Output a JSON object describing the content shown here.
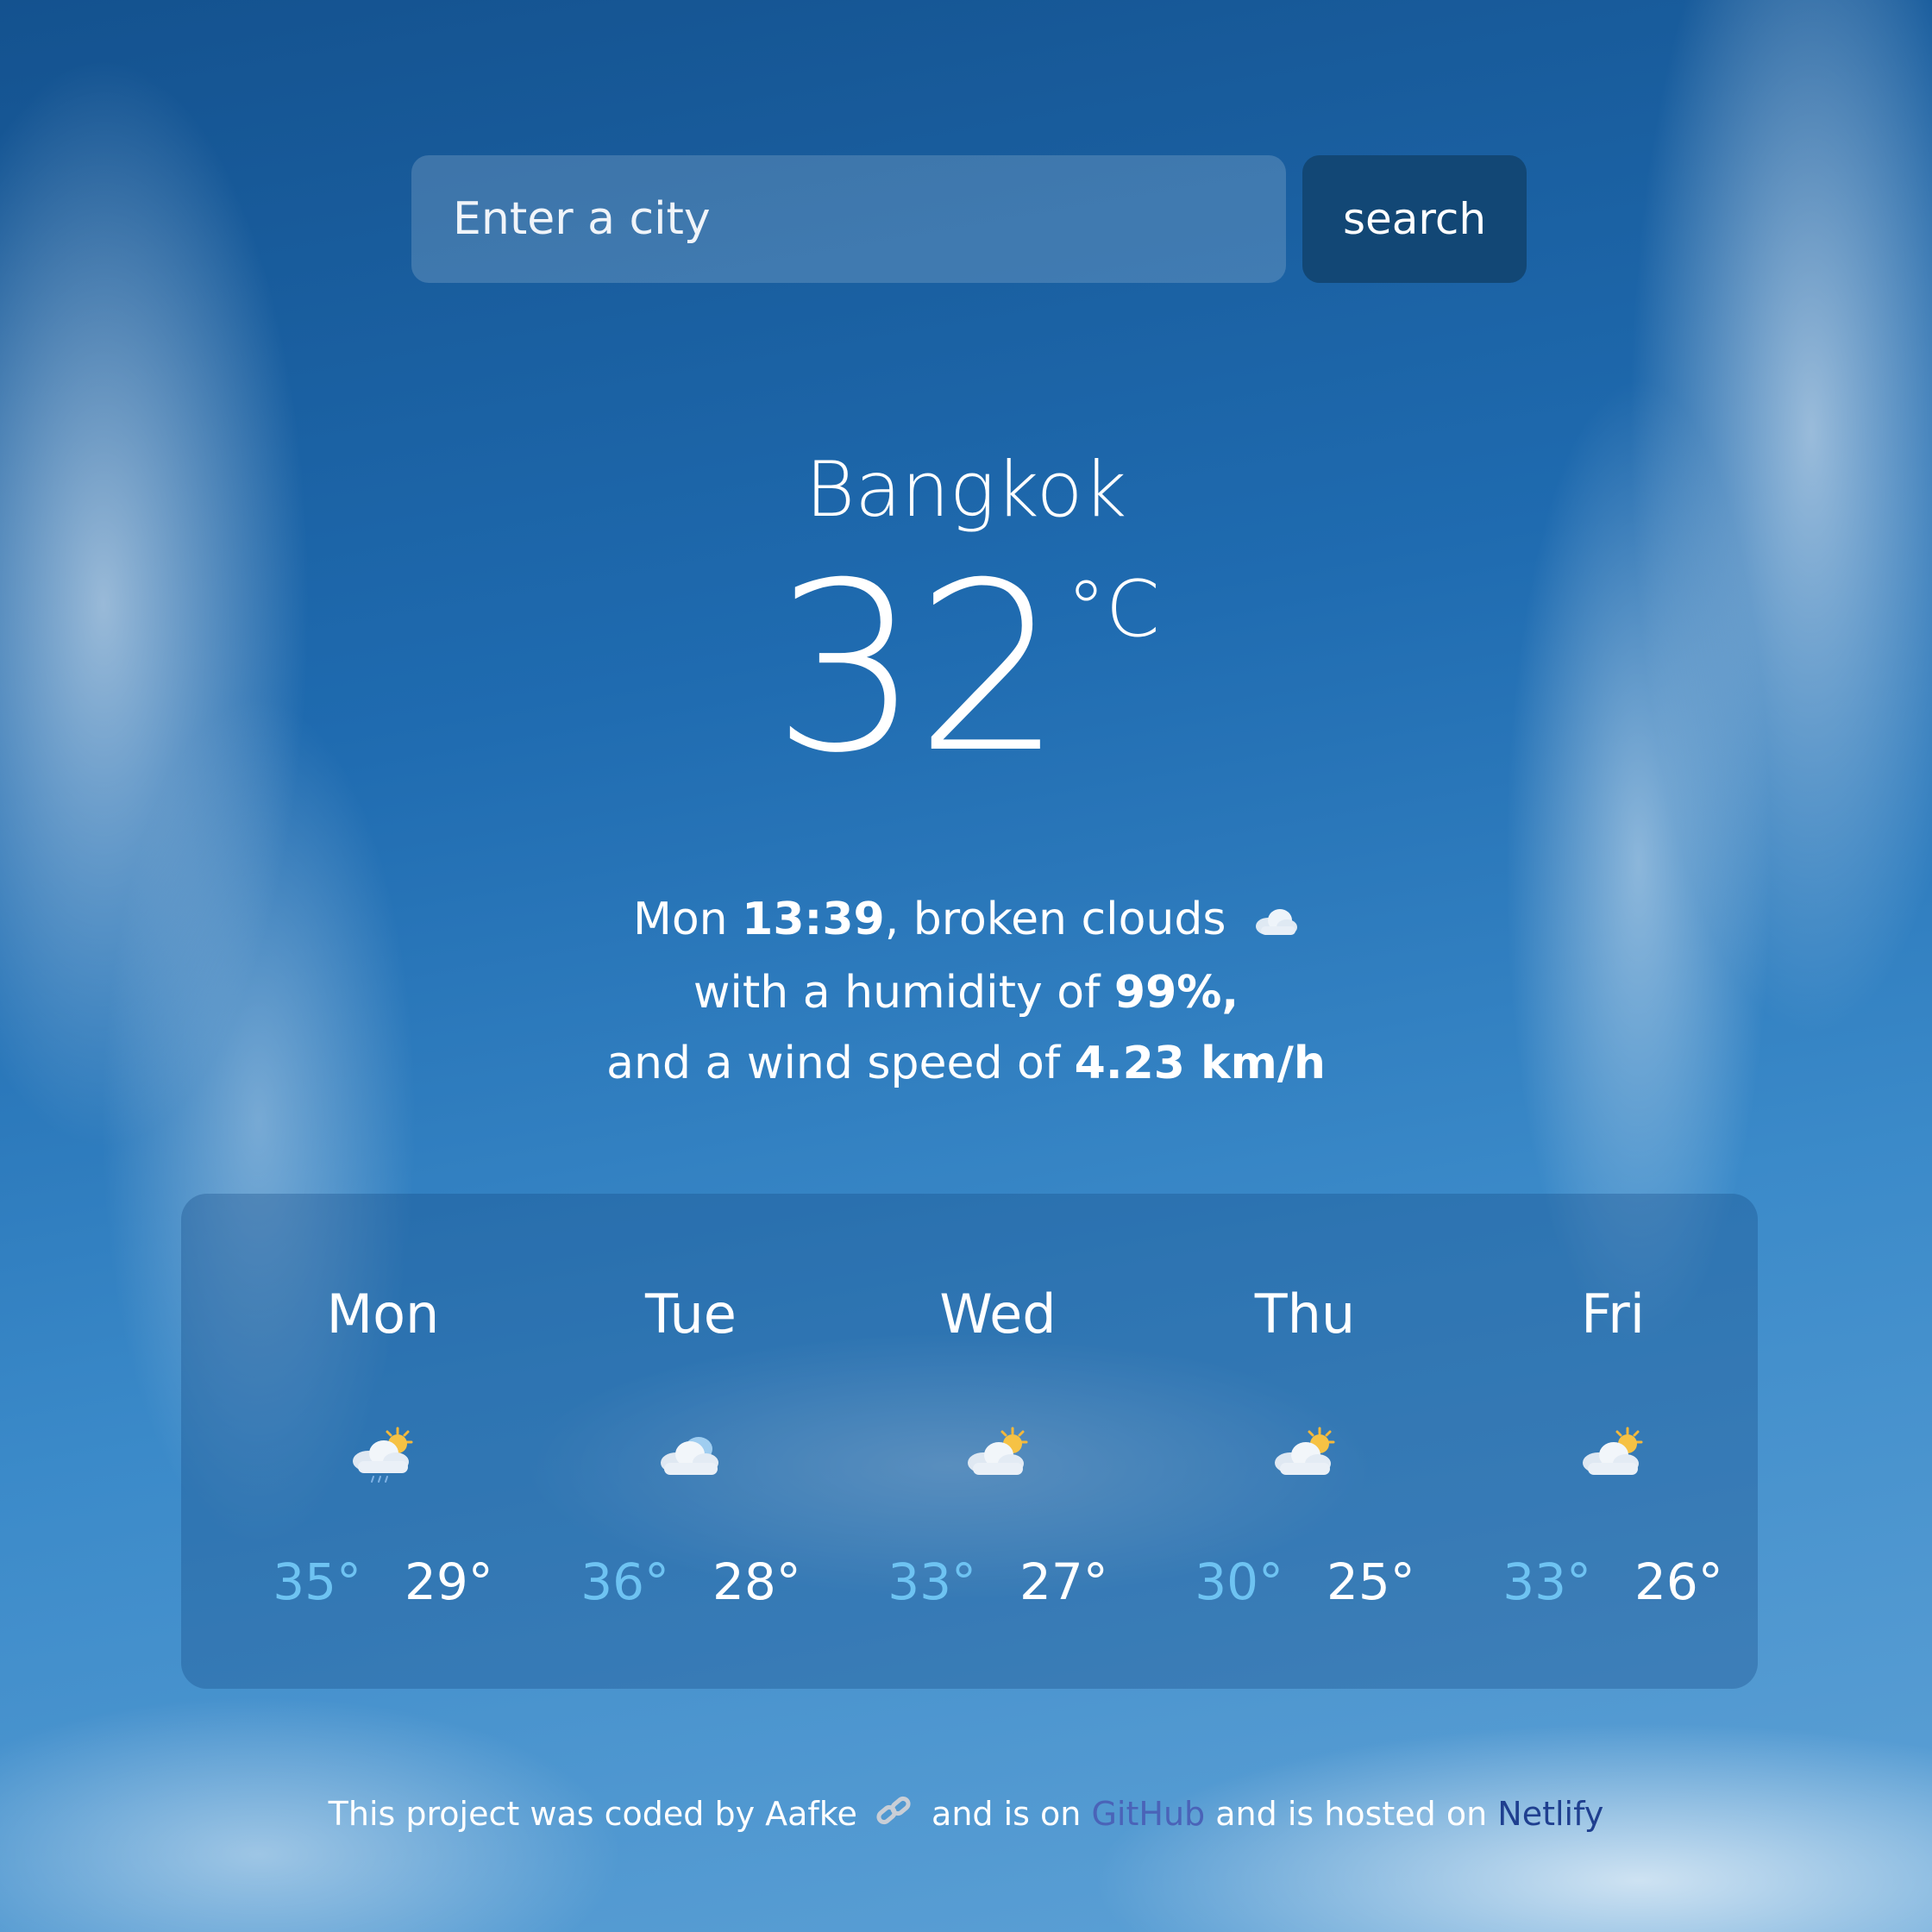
{
  "search": {
    "placeholder": "Enter a city",
    "button_label": "search"
  },
  "current": {
    "city": "Bangkok",
    "temperature": "32",
    "unit": "°C",
    "day": "Mon",
    "time": "13:39",
    "condition": "broken clouds",
    "condition_icon": "cloud-icon",
    "humidity_prefix": "with a humidity of",
    "humidity": "99%,",
    "wind_prefix": "and a wind speed of",
    "wind": "4.23 km/h"
  },
  "forecast": [
    {
      "day": "Mon",
      "icon": "sun-cloud-rain-icon",
      "max": "35°",
      "min": "29°"
    },
    {
      "day": "Tue",
      "icon": "cloud-icon",
      "max": "36°",
      "min": "28°"
    },
    {
      "day": "Wed",
      "icon": "sun-cloud-icon",
      "max": "33°",
      "min": "27°"
    },
    {
      "day": "Thu",
      "icon": "sun-cloud-icon",
      "max": "30°",
      "min": "25°"
    },
    {
      "day": "Fri",
      "icon": "sun-cloud-icon",
      "max": "33°",
      "min": "26°"
    }
  ],
  "footer": {
    "text_1": "This project was coded by Aafke",
    "link_icon": "link-icon",
    "text_2": "and is on",
    "github": "GitHub",
    "text_3": "and is hosted on",
    "netlify": "Netlify"
  },
  "colors": {
    "max_temp": "#6ec3f2",
    "button": "#124775",
    "github_link": "#4a63b8",
    "netlify_link": "#1f3f8f"
  }
}
